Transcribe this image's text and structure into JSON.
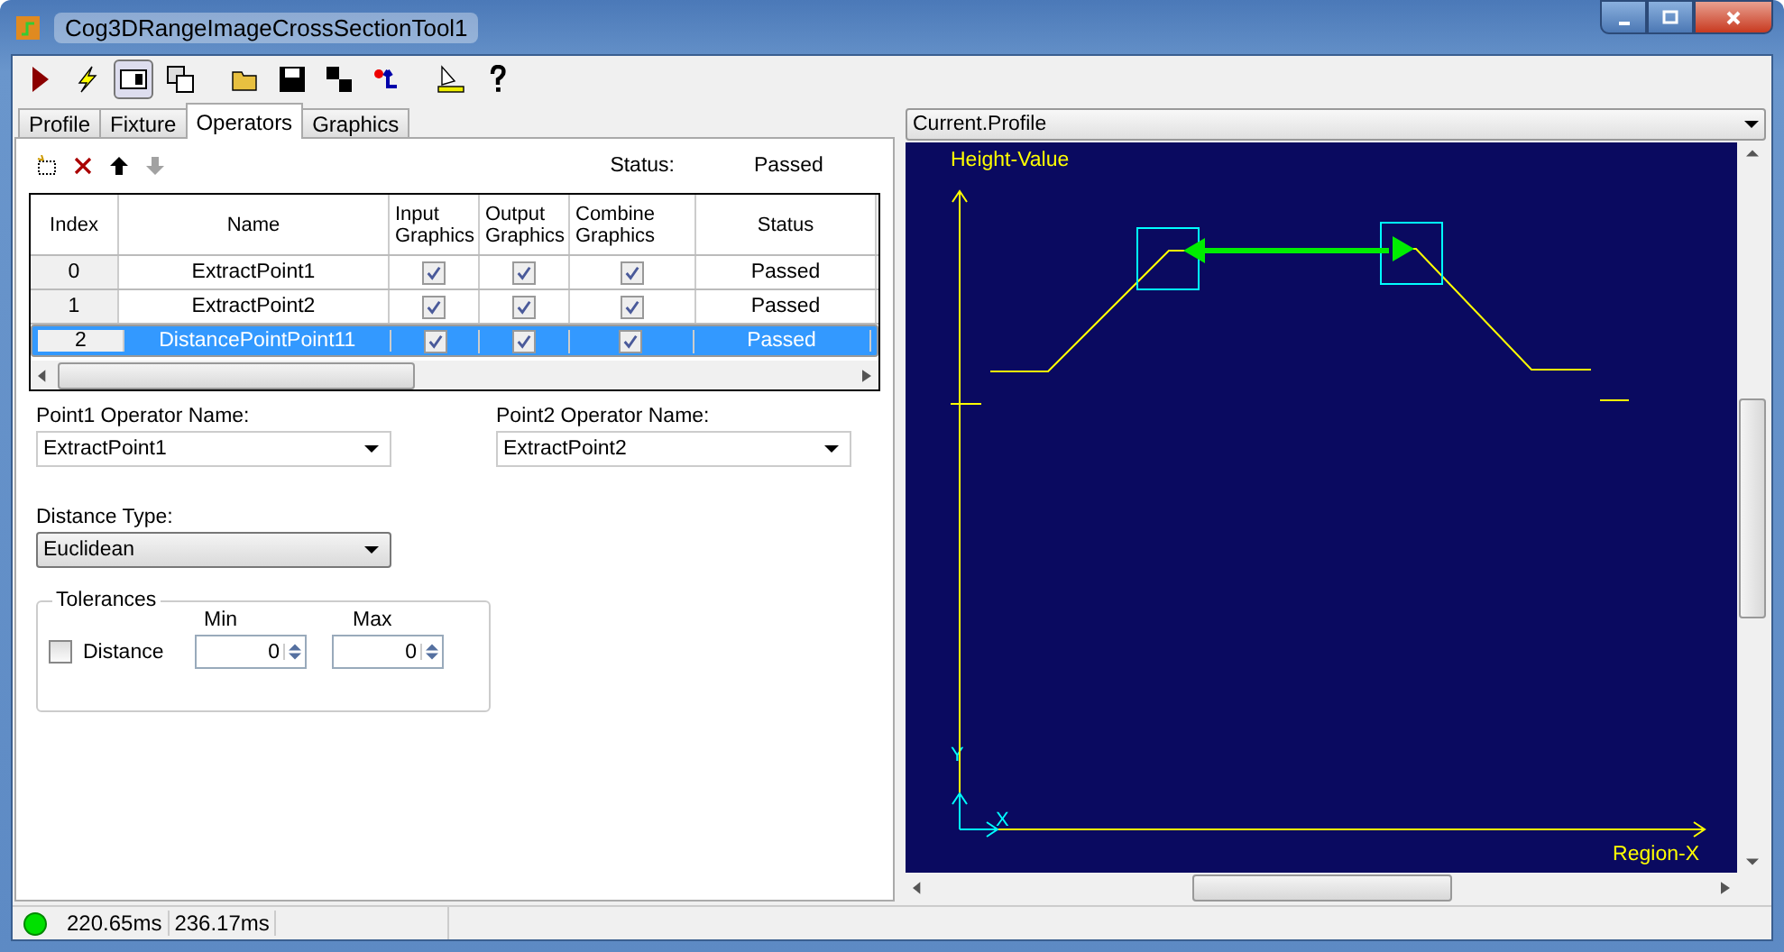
{
  "window": {
    "title": "Cog3DRangeImageCrossSectionTool1"
  },
  "toolbar": [
    {
      "kind": "run",
      "pressed": false
    },
    {
      "kind": "electric",
      "pressed": false
    },
    {
      "kind": "panel",
      "pressed": true
    },
    {
      "kind": "floating",
      "pressed": false
    },
    {
      "kind": "open",
      "pressed": false
    },
    {
      "kind": "save",
      "pressed": false
    },
    {
      "kind": "saveas",
      "pressed": false
    },
    {
      "kind": "reset",
      "pressed": false
    },
    {
      "kind": "measure",
      "pressed": false
    },
    {
      "kind": "help",
      "pressed": false
    }
  ],
  "tabs": [
    {
      "label": "Profile",
      "selected": false
    },
    {
      "label": "Fixture",
      "selected": false
    },
    {
      "label": "Operators",
      "selected": true
    },
    {
      "label": "Graphics",
      "selected": false
    }
  ],
  "operators": {
    "toolbar": [
      {
        "kind": "add",
        "disabled": false
      },
      {
        "kind": "delete",
        "disabled": false
      },
      {
        "kind": "up",
        "disabled": false
      },
      {
        "kind": "down",
        "disabled": true
      }
    ],
    "status_label": "Status:",
    "status_value": "Passed",
    "table": {
      "columns": [
        "Index",
        "Name",
        "Input Graphics",
        "Output Graphics",
        "Combine Graphics",
        "Status"
      ],
      "rows": [
        {
          "index": "0",
          "name": "ExtractPoint1",
          "input_graphics": true,
          "output_graphics": true,
          "combine_graphics": true,
          "status": "Passed",
          "selected": false
        },
        {
          "index": "1",
          "name": "ExtractPoint2",
          "input_graphics": true,
          "output_graphics": true,
          "combine_graphics": true,
          "status": "Passed",
          "selected": false
        },
        {
          "index": "2",
          "name": "DistancePointPoint11",
          "input_graphics": true,
          "output_graphics": true,
          "combine_graphics": true,
          "status": "Passed",
          "selected": true
        }
      ]
    }
  },
  "form": {
    "point1_label": "Point1 Operator Name:",
    "point1_value": "ExtractPoint1",
    "point2_label": "Point2 Operator Name:",
    "point2_value": "ExtractPoint2",
    "distance_type_label": "Distance Type:",
    "distance_type_value": "Euclidean",
    "tolerances": {
      "title": "Tolerances",
      "min_label": "Min",
      "max_label": "Max",
      "rows": [
        {
          "label": "Distance",
          "checked": false,
          "min": "0",
          "max": "0"
        }
      ]
    }
  },
  "view": {
    "selector": "Current.Profile",
    "y_axis_label": "Height-Value",
    "x_axis_label": "Region-X",
    "origin_y": "Y",
    "origin_x": "X"
  },
  "status_bar": {
    "times": [
      "220.65ms",
      "236.17ms"
    ]
  }
}
